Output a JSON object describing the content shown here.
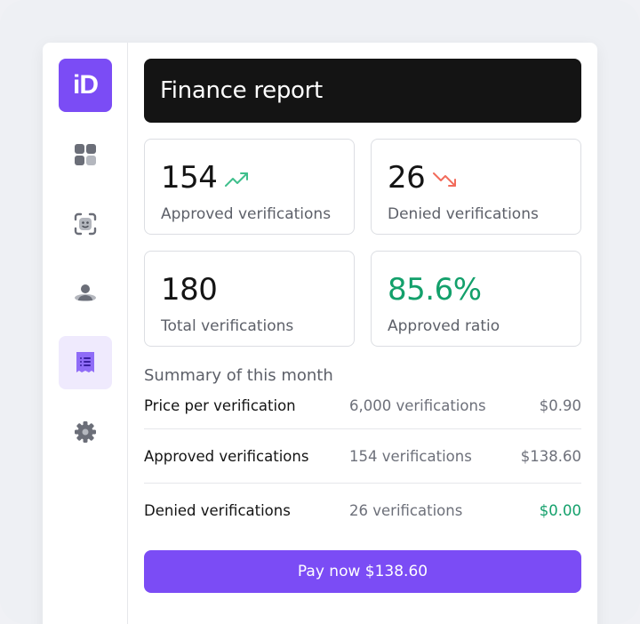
{
  "brand": {
    "logo_text": "iD",
    "color": "#7b4cf5"
  },
  "sidebar": {
    "items": [
      {
        "icon": "dashboard-grid-icon",
        "active": false
      },
      {
        "icon": "face-scan-icon",
        "active": false
      },
      {
        "icon": "users-icon",
        "active": false
      },
      {
        "icon": "receipt-icon",
        "active": true
      },
      {
        "icon": "gear-icon",
        "active": false
      }
    ]
  },
  "header": {
    "title": "Finance report"
  },
  "stats": {
    "approved": {
      "value": "154",
      "label": "Approved verifications",
      "trend": "up"
    },
    "denied": {
      "value": "26",
      "label": "Denied verifications",
      "trend": "down"
    },
    "total": {
      "value": "180",
      "label": "Total verifications"
    },
    "ratio": {
      "value": "85.6%",
      "label": "Approved ratio"
    }
  },
  "summary": {
    "title": "Summary of this month",
    "rows": [
      {
        "label": "Price per verification",
        "count": "6,000 verifications",
        "amount": "$0.90"
      },
      {
        "label": "Approved verifications",
        "count": "154 verifications",
        "amount": "$138.60"
      },
      {
        "label": "Denied verifications",
        "count": "26 verifications",
        "amount": "$0.00"
      }
    ]
  },
  "actions": {
    "pay_label": "Pay now $138.60"
  },
  "colors": {
    "accent": "#7b4cf5",
    "success": "#13a06b",
    "danger": "#f26b5b",
    "header_bg": "#141414"
  }
}
